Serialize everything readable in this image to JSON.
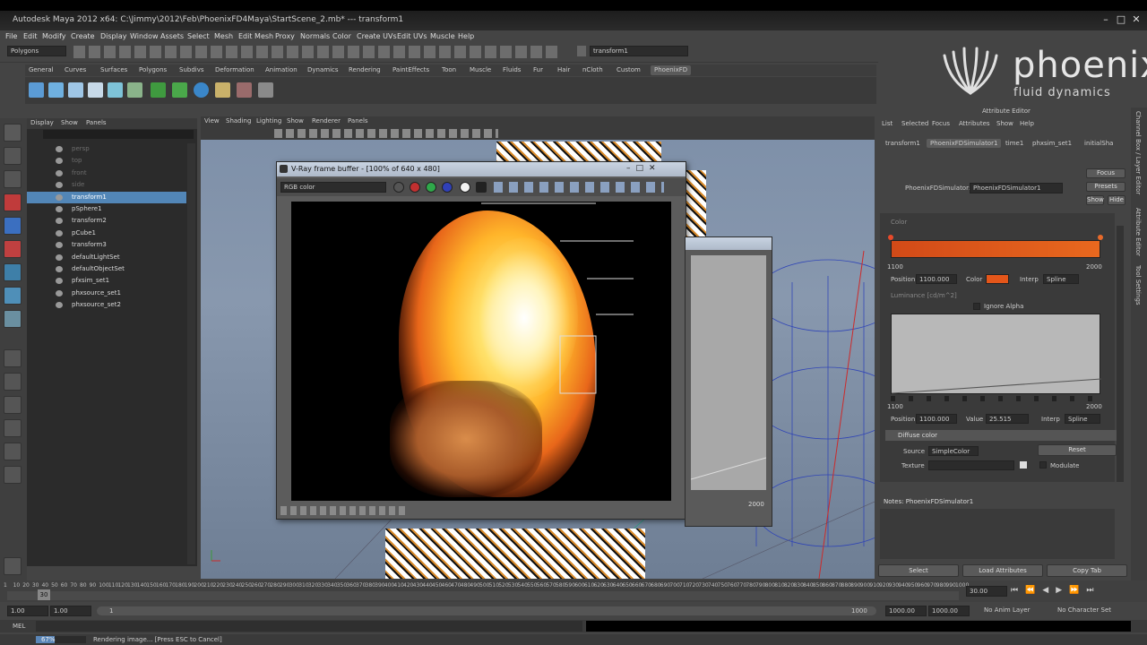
{
  "window": {
    "title": "Autodesk Maya 2012 x64: C:\\Jimmy\\2012\\Feb\\PhoenixFD4Maya\\StartScene_2.mb*  ---  transform1"
  },
  "menubar": [
    "File",
    "Edit",
    "Modify",
    "Create",
    "Display",
    "Window",
    "Assets",
    "Select",
    "Mesh",
    "Edit Mesh",
    "Proxy",
    "Normals",
    "Color",
    "Create UVs",
    "Edit UVs",
    "Muscle",
    "Help"
  ],
  "statusline": {
    "mode": "Polygons",
    "name_field": "transform1"
  },
  "shelf_tabs": [
    "General",
    "Curves",
    "Surfaces",
    "Polygons",
    "Subdivs",
    "Deformation",
    "Animation",
    "Dynamics",
    "Rendering",
    "PaintEffects",
    "Toon",
    "Muscle",
    "Fluids",
    "Fur",
    "Hair",
    "nCloth",
    "Custom",
    "PhoenixFD"
  ],
  "shelf_active": "PhoenixFD",
  "outliner": {
    "menu": [
      "Display",
      "Show",
      "Panels"
    ],
    "items": [
      {
        "label": "persp",
        "dim": true,
        "selected": false
      },
      {
        "label": "top",
        "dim": true,
        "selected": false
      },
      {
        "label": "front",
        "dim": true,
        "selected": false
      },
      {
        "label": "side",
        "dim": true,
        "selected": false
      },
      {
        "label": "transform1",
        "dim": false,
        "selected": true
      },
      {
        "label": "pSphere1",
        "dim": false,
        "selected": false
      },
      {
        "label": "transform2",
        "dim": false,
        "selected": false
      },
      {
        "label": "pCube1",
        "dim": false,
        "selected": false
      },
      {
        "label": "transform3",
        "dim": false,
        "selected": false
      },
      {
        "label": "defaultLightSet",
        "dim": false,
        "selected": false
      },
      {
        "label": "defaultObjectSet",
        "dim": false,
        "selected": false
      },
      {
        "label": "pfxsim_set1",
        "dim": false,
        "selected": false
      },
      {
        "label": "phxsource_set1",
        "dim": false,
        "selected": false
      },
      {
        "label": "phxsource_set2",
        "dim": false,
        "selected": false
      }
    ]
  },
  "viewport": {
    "menu": [
      "View",
      "Shading",
      "Lighting",
      "Show",
      "Renderer",
      "Panels"
    ]
  },
  "vray": {
    "title": "V-Ray frame buffer - [100% of 640 x 480]",
    "channel": "RGB color"
  },
  "graph_window": {
    "axis_value": "2000"
  },
  "logo": {
    "word": "phoenix",
    "sub": "fluid dynamics"
  },
  "attribute_editor": {
    "header": "Attribute Editor",
    "menu": [
      "List",
      "Selected",
      "Focus",
      "Attributes",
      "Show",
      "Help"
    ],
    "tabs": [
      "transform1",
      "PhoenixFDSimulator1",
      "time1",
      "phxsim_set1",
      "initialSha"
    ],
    "active_tab": "PhoenixFDSimulator1",
    "node_label": "PhoenixFDSimulator:",
    "node_value": "PhoenixFDSimulator1",
    "buttons": {
      "focus": "Focus",
      "presets": "Presets",
      "show": "Show",
      "hide": "Hide"
    },
    "color_section": "Color",
    "color_min": "1100",
    "color_max": "2000",
    "color_position_label": "Position",
    "color_position": "1100.000",
    "color_label": "Color",
    "interp_label": "Interp",
    "interp_value": "Spline",
    "luminance_section": "Luminance [cd/m^2]",
    "ignore_alpha": "Ignore Alpha",
    "lum_min": "1100",
    "lum_max": "2000",
    "lum_position_label": "Position",
    "lum_position": "1100.000",
    "value_label": "Value",
    "value_value": "25.515",
    "lum_interp_label": "Interp",
    "lum_interp_value": "Spline",
    "diffuse_section": "Diffuse color",
    "source_label": "Source",
    "source_value": "SimpleColor",
    "reset": "Reset",
    "texture_label": "Texture",
    "modulate": "Modulate",
    "notes": "Notes: PhoenixFDSimulator1",
    "bottom_buttons": [
      "Select",
      "Load Attributes",
      "Copy Tab"
    ],
    "side_tabs": [
      "Channel Box / Layer Editor",
      "Attribute Editor",
      "Tool Settings"
    ]
  },
  "timeline": {
    "ticks": [
      "1",
      "10",
      "20",
      "30",
      "40",
      "50",
      "60",
      "70",
      "80",
      "90",
      "100",
      "110",
      "120",
      "130",
      "140",
      "150",
      "160",
      "170",
      "180",
      "190",
      "200",
      "210",
      "220",
      "230",
      "240",
      "250",
      "260",
      "270",
      "280",
      "290",
      "300",
      "310",
      "320",
      "330",
      "340",
      "350",
      "360",
      "370",
      "380",
      "390",
      "400",
      "410",
      "420",
      "430",
      "440",
      "450",
      "460",
      "470",
      "480",
      "490",
      "500",
      "510",
      "520",
      "530",
      "540",
      "550",
      "560",
      "570",
      "580",
      "590",
      "600",
      "610",
      "620",
      "630",
      "640",
      "650",
      "660",
      "670",
      "680",
      "690",
      "700",
      "710",
      "720",
      "730",
      "740",
      "750",
      "760",
      "770",
      "780",
      "790",
      "800",
      "810",
      "820",
      "830",
      "840",
      "850",
      "860",
      "870",
      "880",
      "890",
      "900",
      "910",
      "920",
      "930",
      "940",
      "950",
      "960",
      "970",
      "980",
      "990",
      "1000"
    ],
    "current_frame": "30",
    "current_field": "30.00"
  },
  "range": {
    "start": "1.00",
    "start2": "1.00",
    "slider_start": "1",
    "slider_end": "1000",
    "end": "1000.00",
    "end2": "1000.00",
    "anim_layer": "No Anim Layer",
    "char_set": "No Character Set"
  },
  "cmdline": {
    "label": "MEL"
  },
  "helpline": {
    "progress": 0.37,
    "progress_label": "67%",
    "message": "Rendering image... [Press ESC to Cancel]"
  }
}
